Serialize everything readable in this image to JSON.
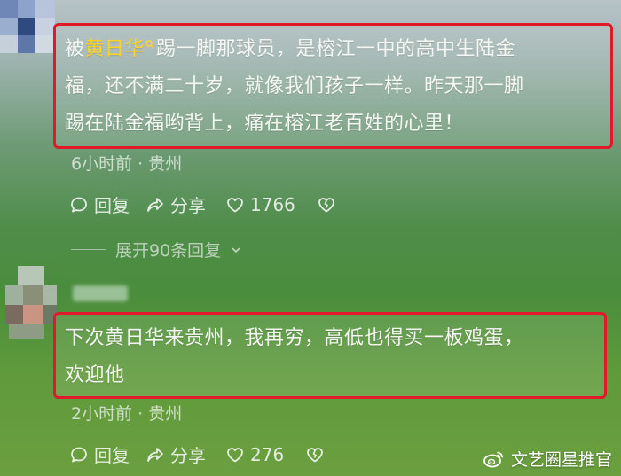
{
  "comments": [
    {
      "mention": "黄日华",
      "text_before": "被",
      "text_after": "踢一脚那球员，是榕江一中的高中生陆金福，还不满二十岁，就像我们孩子一样。昨天那一脚踢在陆金福哟背上，痛在榕江老百姓的心里！",
      "line1_rest": "踢一脚那球员，是榕江一中的高中生陆金",
      "line2": "福，还不满二十岁，就像我们孩子一样。昨天那一脚",
      "line3": "踢在陆金福哟背上，痛在榕江老百姓的心里！",
      "time": "6小时前",
      "location": "贵州",
      "reply_label": "回复",
      "share_label": "分享",
      "likes": "1766",
      "expand_label": "展开90条回复"
    },
    {
      "line1": "下次黄日华来贵州，我再穷，高低也得买一板鸡蛋，",
      "line2": "欢迎他",
      "time": "2小时前",
      "location": "贵州",
      "reply_label": "回复",
      "share_label": "分享",
      "likes": "276"
    }
  ],
  "meta_separator": " · ",
  "watermark": {
    "icon": "weibo-icon",
    "text": "文艺圈星推官"
  },
  "colors": {
    "highlight_border": "#e0192b",
    "mention": "#ffd12e"
  }
}
